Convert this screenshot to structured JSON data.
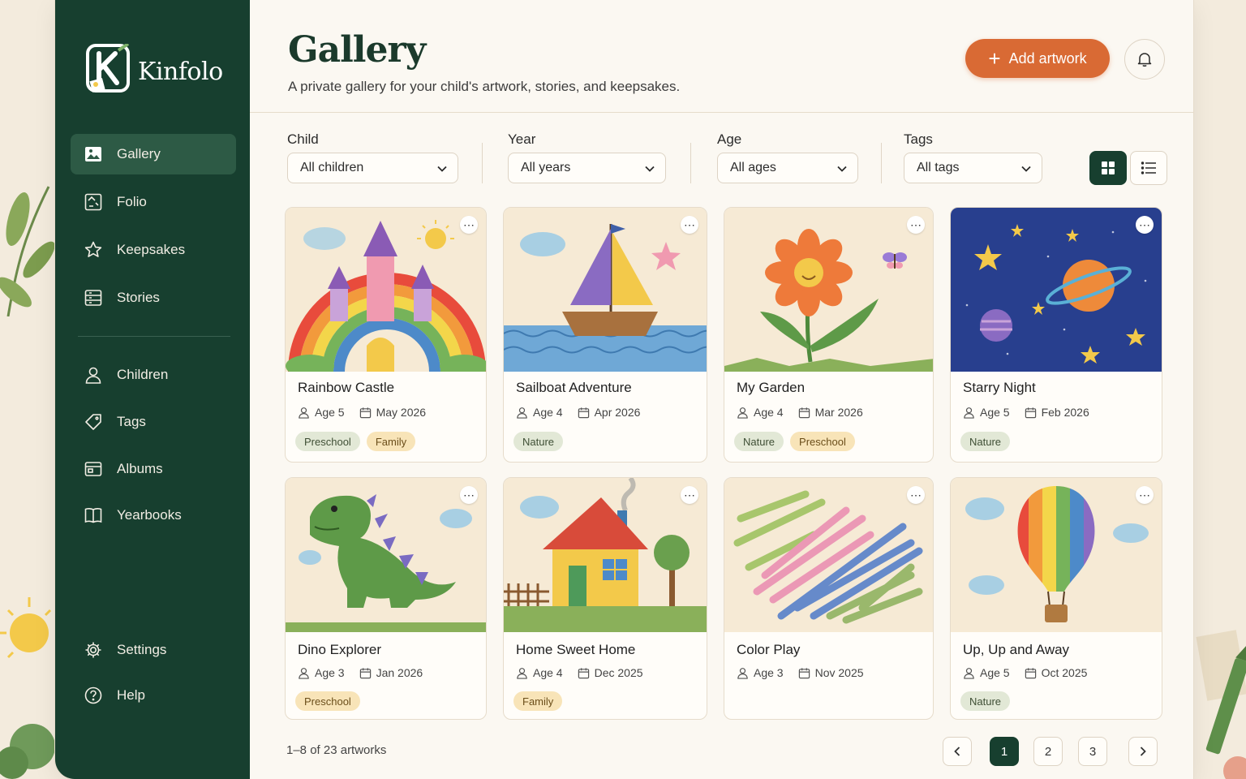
{
  "brand": {
    "name": "Kinfolo",
    "logo_letter": "K"
  },
  "sidebar": {
    "items": [
      {
        "label": "Gallery",
        "icon": "image-icon",
        "active": true
      },
      {
        "label": "Folio",
        "icon": "folio-icon",
        "active": false
      },
      {
        "label": "Keepsakes",
        "icon": "star-icon",
        "active": false
      },
      {
        "label": "Stories",
        "icon": "stories-icon",
        "active": false
      },
      {
        "label": "Children",
        "icon": "person-icon",
        "active": false
      },
      {
        "label": "Tags",
        "icon": "tag-icon",
        "active": false
      },
      {
        "label": "Albums",
        "icon": "album-icon",
        "active": false
      },
      {
        "label": "Yearbooks",
        "icon": "book-icon",
        "active": false
      },
      {
        "label": "Settings",
        "icon": "gear-icon",
        "active": false
      },
      {
        "label": "Help",
        "icon": "help-icon",
        "active": false
      }
    ]
  },
  "header": {
    "title": "Gallery",
    "subtitle": "A private gallery for your child's artwork, stories, and keepsakes.",
    "add_label": "Add artwork"
  },
  "filters": [
    {
      "label": "Child",
      "value": "All children"
    },
    {
      "label": "Year",
      "value": "All years"
    },
    {
      "label": "Age",
      "value": "All ages"
    },
    {
      "label": "Tags",
      "value": "All tags"
    }
  ],
  "view": {
    "mode": "grid"
  },
  "artworks": [
    {
      "title": "Rainbow Castle",
      "age": "Age 5",
      "date": "May 2026",
      "tags": [
        "Preschool",
        "Family"
      ]
    },
    {
      "title": "Sailboat Adventure",
      "age": "Age 4",
      "date": "Apr 2026",
      "tags": [
        "Nature"
      ]
    },
    {
      "title": "My Garden",
      "age": "Age 4",
      "date": "Mar 2026",
      "tags": [
        "Nature",
        "Preschool"
      ]
    },
    {
      "title": "Starry Night",
      "age": "Age 5",
      "date": "Feb 2026",
      "tags": [
        "Nature"
      ]
    },
    {
      "title": "Dino Explorer",
      "age": "Age 3",
      "date": "Jan 2026",
      "tags": [
        "Preschool"
      ]
    },
    {
      "title": "Home Sweet Home",
      "age": "Age 4",
      "date": "Dec 2025",
      "tags": [
        "Family"
      ]
    },
    {
      "title": "Color Play",
      "age": "Age 3",
      "date": "Nov 2025",
      "tags": []
    },
    {
      "title": "Up, Up and Away",
      "age": "Age 5",
      "date": "Oct 2025",
      "tags": [
        "Nature"
      ]
    }
  ],
  "pagination": {
    "summary": "1–8 of 23 artworks",
    "pages": [
      "1",
      "2",
      "3"
    ],
    "current": "1"
  },
  "colors": {
    "sidebar": "#173f2f",
    "accent": "#d96a34",
    "page_bg": "#fbf8f2"
  }
}
